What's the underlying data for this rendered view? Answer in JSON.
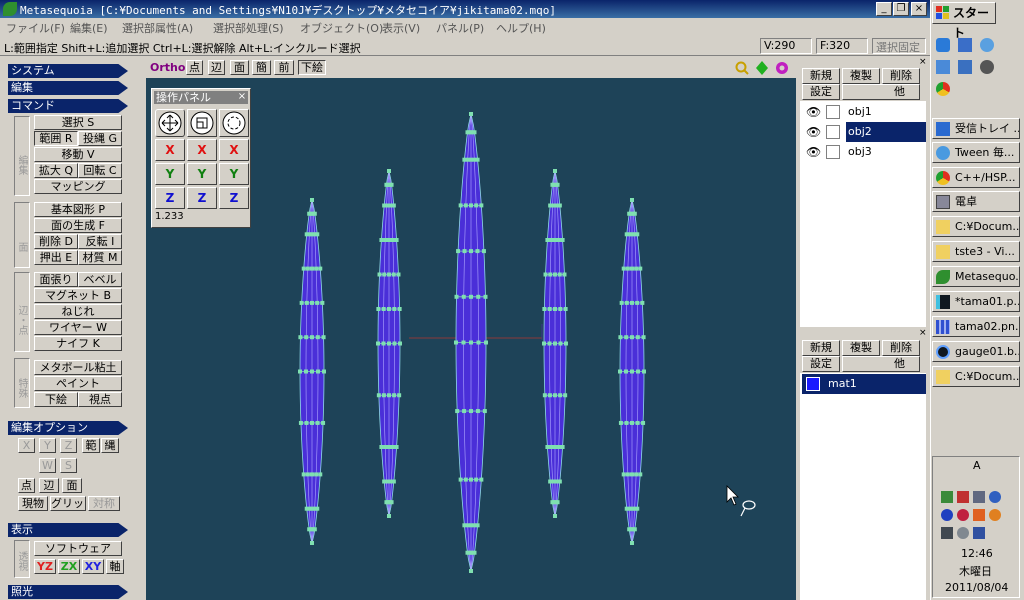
{
  "window": {
    "title": "Metasequoia [C:¥Documents and Settings¥N10J¥デスクトップ¥メタセコイア¥jikitama02.mqo]",
    "minimize": "_",
    "restore": "❐",
    "close": "×"
  },
  "menu": [
    "ファイル(F)",
    "編集(E)",
    "選択部属性(A)",
    "選択部処理(S)",
    "オブジェクト(O)",
    "表示(V)",
    "パネル(P)",
    "ヘルプ(H)"
  ],
  "status": {
    "hint": "L:範囲指定  Shift+L:追加選択  Ctrl+L:選択解除  Alt+L:インクルード選択",
    "vertices": "V:290",
    "faces": "F:320",
    "fixed": "選択固定"
  },
  "left": {
    "system": "システム",
    "edit": "編集",
    "command": "コマンド",
    "group_edit": "編集",
    "group_face": "面",
    "group_edgepoint": "辺・点",
    "group_special": "特殊",
    "select": "選択 S",
    "range": "範囲 R",
    "lasso": "投縄 G",
    "move": "移動 V",
    "scale": "拡大 Q",
    "rotate": "回転 C",
    "mapping": "マッピング",
    "primitive": "基本図形 P",
    "face_gen": "面の生成 F",
    "delete": "削除 D",
    "invert": "反転 I",
    "extrude": "押出 E",
    "material": "材質 M",
    "stretch": "面張り",
    "bevel": "ベベル",
    "magnet": "マグネット B",
    "twist": "ねじれ",
    "wire": "ワイヤー W",
    "knife": "ナイフ K",
    "metaball": "メタボール粘土",
    "paint": "ペイント",
    "underlay": "下絵",
    "viewpoint": "視点",
    "edit_option": "編集オプション",
    "opt_x": "X",
    "opt_y": "Y",
    "opt_z": "Z",
    "opt_range": "範",
    "opt_rope": "縄",
    "opt_w": "W",
    "opt_s": "S",
    "opt_point": "点",
    "opt_edge": "辺",
    "opt_face": "面",
    "opt_current": "現物",
    "opt_grid": "グリッド",
    "opt_sym": "対称",
    "display": "表示",
    "group_persp": "透視",
    "software": "ソフトウェア",
    "yz": "YZ",
    "zx": "ZX",
    "xy": "XY",
    "axis": "軸",
    "lighting": "照光"
  },
  "viewbar": {
    "ortho": "Ortho",
    "point": "点",
    "edge": "辺",
    "face": "面",
    "simple": "簡",
    "front": "前",
    "underlay": "下絵"
  },
  "oppanel": {
    "title": "操作パネル",
    "close": "×",
    "x": "X",
    "y": "Y",
    "z": "Z",
    "value": "1.233"
  },
  "objpanel": {
    "new": "新規",
    "copy": "複製",
    "delete": "削除",
    "settings": "設定",
    "other": "他",
    "objects": [
      "obj1",
      "obj2",
      "obj3"
    ]
  },
  "matpanel": {
    "new": "新規",
    "copy": "複製",
    "delete": "削除",
    "settings": "設定",
    "other": "他",
    "materials": [
      "mat1"
    ],
    "mat_color": "#1a1aff"
  },
  "taskbar": {
    "start": "スタート",
    "tasks": [
      "受信トレイ ...",
      "Tween 毎...",
      "C++/HSP...",
      "電卓",
      "C:¥Docum...",
      "tste3 - Vi...",
      "Metasequo...",
      "*tama01.p...",
      "tama02.pn...",
      "gauge01.b...",
      "C:¥Docum..."
    ],
    "ime": "A",
    "time": "12:46",
    "day": "木曜日",
    "date": "2011/08/04"
  },
  "colors": {
    "titlebar": "#0a246a",
    "viewport": "#1e4358",
    "mesh_fill": "#4a2fd8",
    "mesh_vertex": "#7fe0b0",
    "selected": "#0a246a"
  }
}
